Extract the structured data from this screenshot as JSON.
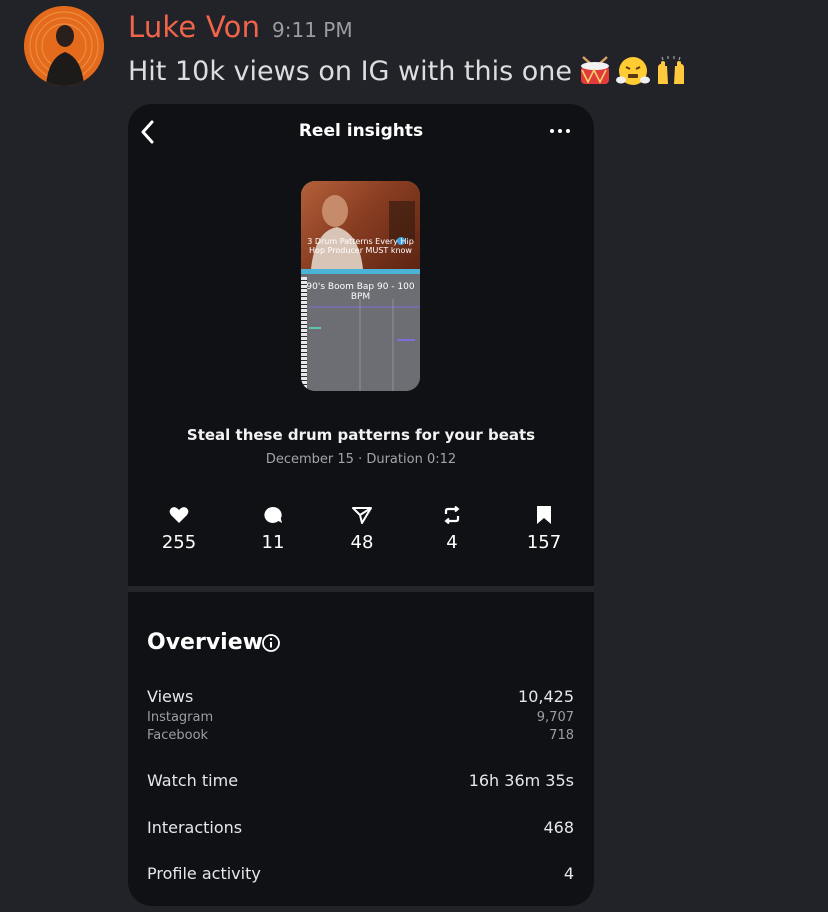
{
  "message": {
    "author": "Luke Von",
    "timestamp": "9:11 PM",
    "text": "Hit 10k views on IG with this one",
    "emoji": [
      "drum-emoji",
      "face-with-steam-emoji",
      "raising-hands-emoji"
    ],
    "author_color": "#f0654a"
  },
  "reel": {
    "header_title": "Reel insights",
    "thumbnail_caption": "3 Drum Patterns Every Hip Hop Producer MUST know",
    "thumbnail_subtext": "90's Boom Bap 90 - 100 BPM",
    "title": "Steal these drum patterns for your beats",
    "meta": "December 15 · Duration 0:12",
    "stats": {
      "likes": "255",
      "comments": "11",
      "shares": "48",
      "reposts": "4",
      "saves": "157"
    },
    "overview": {
      "title": "Overview",
      "views_label": "Views",
      "views_value": "10,425",
      "instagram_label": "Instagram",
      "instagram_value": "9,707",
      "facebook_label": "Facebook",
      "facebook_value": "718",
      "watch_time_label": "Watch time",
      "watch_time_value": "16h 36m 35s",
      "interactions_label": "Interactions",
      "interactions_value": "468",
      "profile_activity_label": "Profile activity",
      "profile_activity_value": "4"
    }
  }
}
